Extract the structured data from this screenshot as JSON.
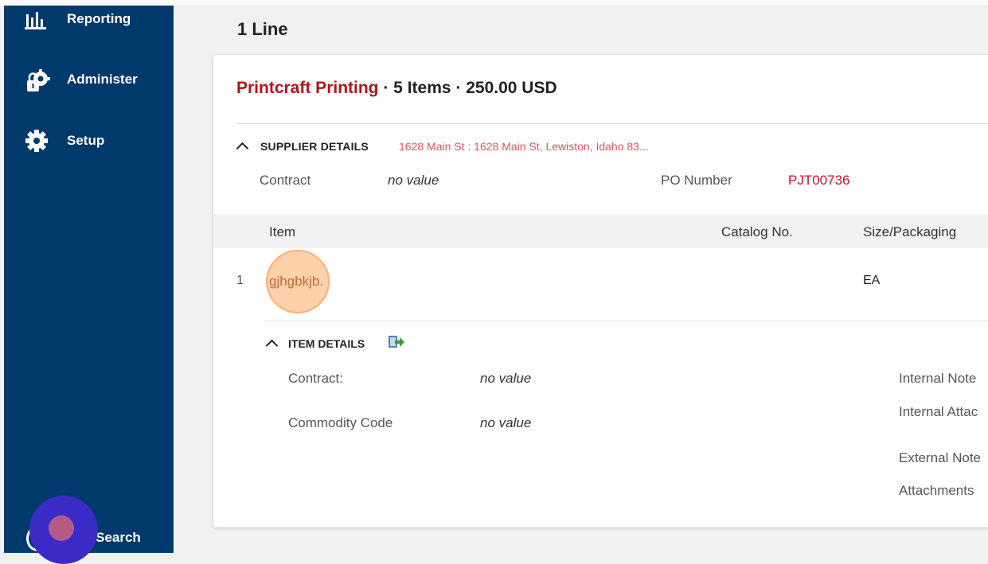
{
  "sidebar": {
    "items": [
      {
        "label": "Reporting",
        "icon": "bar-chart-icon"
      },
      {
        "label": "Administer",
        "icon": "admin-gear-lock-icon"
      },
      {
        "label": "Setup",
        "icon": "gear-icon"
      }
    ],
    "search_label": "u Search",
    "search_icon": "search-icon"
  },
  "main": {
    "heading": "1 Line",
    "supplier": {
      "name": "Printcraft Printing",
      "summary": " · 5 Items · 250.00 USD"
    },
    "supplier_details": {
      "toggle_label": "SUPPLIER DETAILS",
      "address": "1628 Main St : 1628 Main St, Lewiston, Idaho 83...",
      "contract_label": "Contract",
      "contract_value": "no value",
      "po_label": "PO Number",
      "po_value": "PJT00736"
    },
    "table": {
      "columns": [
        "Item",
        "Catalog No.",
        "Size/Packaging"
      ],
      "rows": [
        {
          "num": "1",
          "item": "gjhgbkjb.",
          "size": "EA"
        }
      ]
    },
    "item_details": {
      "toggle_label": "ITEM DETAILS",
      "export_icon": "export-icon",
      "contract_label": "Contract:",
      "contract_value": "no value",
      "commodity_label": "Commodity Code",
      "commodity_value": "no value",
      "internal_note_label": "Internal Note",
      "internal_attach_label": "Internal Attac",
      "external_note_label": "External Note",
      "attachments_label": "Attachments"
    }
  },
  "colors": {
    "sidebar": "#00396b",
    "supplier_name": "#b5121b",
    "link": "#e0545f",
    "po_number": "#c8102e"
  }
}
